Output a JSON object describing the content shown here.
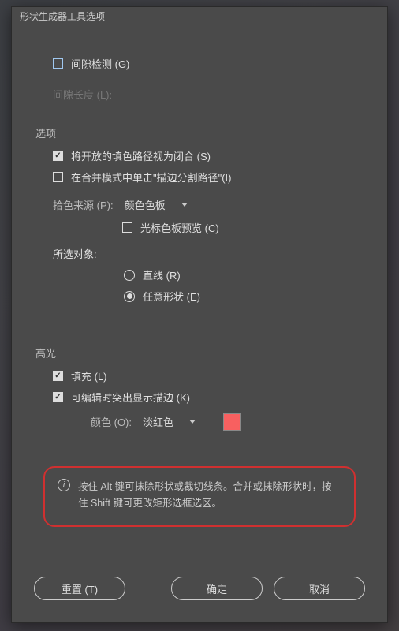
{
  "dialog": {
    "title": "形状生成器工具选项"
  },
  "gap_detection": {
    "label": "间隙检测 (G)",
    "checked": false,
    "length_label": "间隙长度 (L):"
  },
  "options": {
    "header": "选项",
    "open_paths_closed": {
      "label": "将开放的填色路径视为闭合 (S)",
      "checked": true
    },
    "merge_click_stroke": {
      "label": "在合并模式中单击\"描边分割路径\"(I)",
      "checked": false
    },
    "pick_color_label": "拾色来源 (P):",
    "pick_color_value": "颜色色板",
    "cursor_preview": {
      "label": "光标色板预览 (C)",
      "checked": false
    },
    "selection_label": "所选对象:",
    "radio_line": {
      "label": "直线 (R)",
      "checked": false
    },
    "radio_freeform": {
      "label": "任意形状 (E)",
      "checked": true
    }
  },
  "highlight": {
    "header": "高光",
    "fill": {
      "label": "填充 (L)",
      "checked": true
    },
    "stroke_edit": {
      "label": "可编辑时突出显示描边 (K)",
      "checked": true
    },
    "color_label": "颜色 (O):",
    "color_value": "淡红色",
    "color_hex": "#f86060"
  },
  "info": {
    "text": "按住 Alt 键可抹除形状或裁切线条。合并或抹除形状时，按住 Shift 键可更改矩形选框选区。"
  },
  "buttons": {
    "reset": "重置 (T)",
    "ok": "确定",
    "cancel": "取消"
  }
}
